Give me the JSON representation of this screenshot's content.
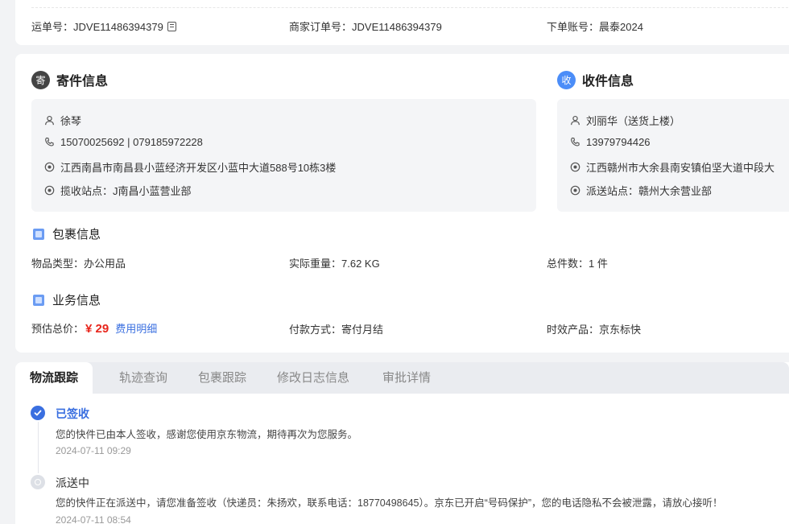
{
  "order": {
    "waybill_label": "运单号：",
    "waybill_no": "JDVE11486394379",
    "merchant_label": "商家订单号：",
    "merchant_no": "JDVE11486394379",
    "account_label": "下单账号：",
    "account": "晨泰2024"
  },
  "sender": {
    "badge": "寄",
    "title": "寄件信息",
    "name": "徐琴",
    "phone": "15070025692 | 079185972228",
    "address": "江西南昌市南昌县小蓝经济开发区小蓝中大道588号10栋3楼",
    "station": "揽收站点：J南昌小蓝营业部"
  },
  "receiver": {
    "badge": "收",
    "title": "收件信息",
    "name": "刘丽华（送货上楼）",
    "phone": "13979794426",
    "address": "江西赣州市大余县南安镇伯坚大道中段大",
    "station": "派送站点：赣州大余营业部"
  },
  "package": {
    "title": "包裹信息",
    "type_label": "物品类型：",
    "type": "办公用品",
    "weight_label": "实际重量：",
    "weight": "7.62 KG",
    "count_label": "总件数：",
    "count": "1 件"
  },
  "business": {
    "title": "业务信息",
    "price_label": "预估总价：",
    "price": "¥ 29",
    "fee_link": "费用明细",
    "pay_label": "付款方式：",
    "pay": "寄付月结",
    "product_label": "时效产品：",
    "product": "京东标快"
  },
  "tabs": [
    "物流跟踪",
    "轨迹查询",
    "包裹跟踪",
    "修改日志信息",
    "审批详情"
  ],
  "timeline": [
    {
      "status": "已签收",
      "desc": "您的快件已由本人签收，感谢您使用京东物流，期待再次为您服务。",
      "time": "2024-07-11 09:29"
    },
    {
      "status": "派送中",
      "desc": "您的快件正在派送中，请您准备签收（快递员：朱扬欢，联系电话：18770498645）。京东已开启“号码保护”，您的电话隐私不会被泄露，请放心接听！",
      "time": "2024-07-11 08:54"
    }
  ],
  "colors": {
    "accent": "#3a6fe0",
    "price": "#e8261c",
    "badge_recv": "#4b8df8"
  }
}
